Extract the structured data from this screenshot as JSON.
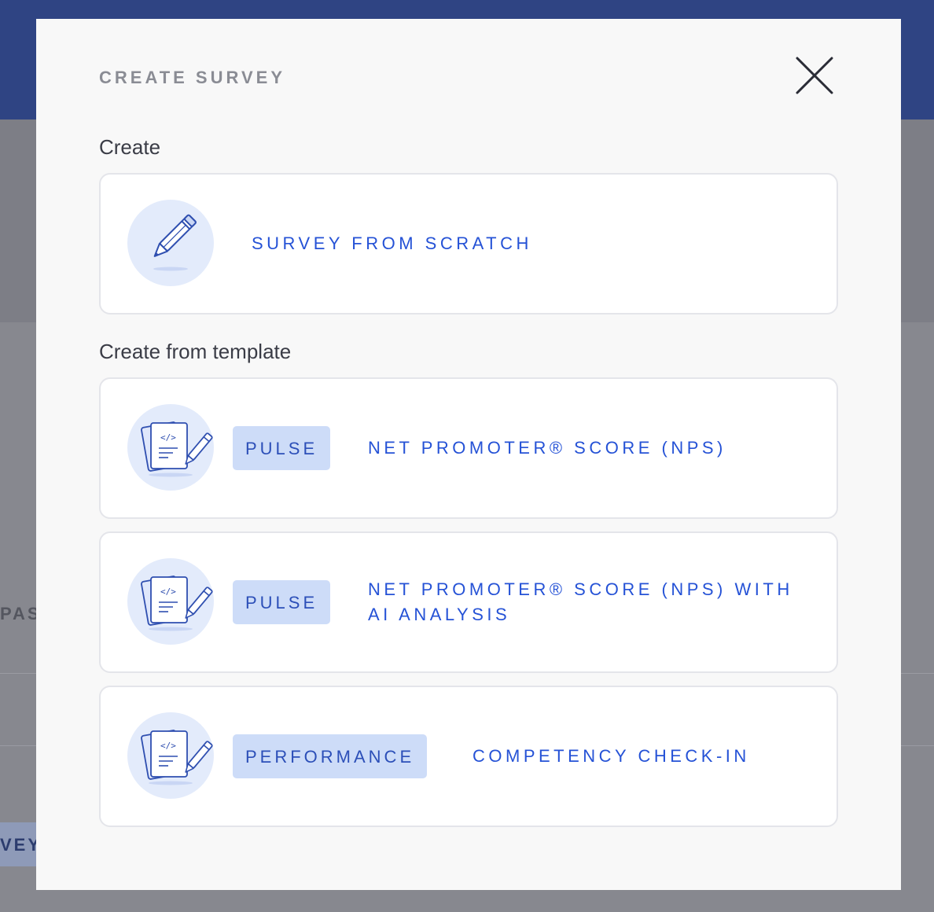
{
  "background": {
    "partial_label": "PAS",
    "partial_button": "VEY"
  },
  "modal": {
    "title": "CREATE SURVEY",
    "close_icon": "close-icon",
    "create_section": {
      "label": "Create",
      "option": {
        "label": "SURVEY FROM SCRATCH",
        "icon": "pencil-icon"
      }
    },
    "template_section": {
      "label": "Create from template",
      "templates": [
        {
          "tag": "PULSE",
          "label": "NET PROMOTER® SCORE (NPS)",
          "icon": "document-pencil-icon"
        },
        {
          "tag": "PULSE",
          "label": "NET PROMOTER® SCORE (NPS) WITH AI ANALYSIS",
          "icon": "document-pencil-icon"
        },
        {
          "tag": "PERFORMANCE",
          "label": "COMPETENCY CHECK-IN",
          "icon": "document-pencil-icon"
        }
      ]
    }
  },
  "colors": {
    "accent": "#2552d6",
    "tag_background": "#cddcf8",
    "icon_background": "#e3ebfb",
    "header_background": "#2f4483"
  }
}
